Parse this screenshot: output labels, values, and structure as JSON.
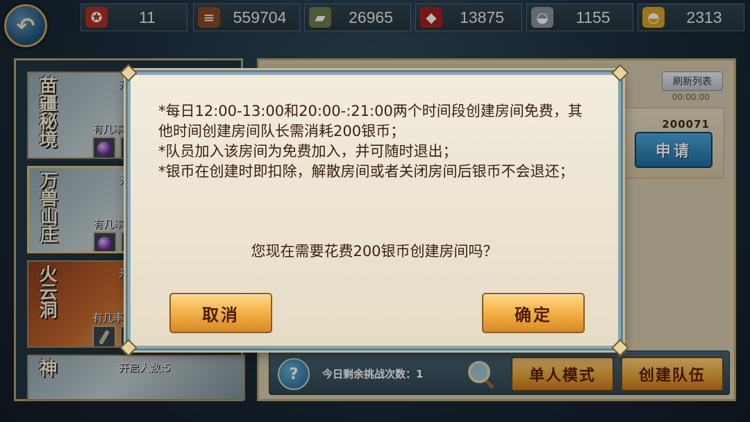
{
  "resources": [
    {
      "icon": "token-icon",
      "value": "11",
      "color": "#b23020"
    },
    {
      "icon": "wood-icon",
      "value": "559704",
      "color": "#8a4a22"
    },
    {
      "icon": "stone-icon",
      "value": "26965",
      "color": "#6f7a4a"
    },
    {
      "icon": "ore-icon",
      "value": "13875",
      "color": "#a32020"
    },
    {
      "icon": "silver-icon",
      "value": "1155",
      "color": "#c0c6cc"
    },
    {
      "icon": "gold-ingot-icon",
      "value": "2313",
      "color": "#d8a520"
    }
  ],
  "dungeons": [
    {
      "name": "苗疆秘境",
      "open": "开启",
      "chance": "有几率掉",
      "selected": false
    },
    {
      "name": "万兽山庄",
      "open": "开启",
      "chance": "有几率掉",
      "selected": true
    },
    {
      "name": "火云洞",
      "open": "开启",
      "chance": "有几率掉",
      "selected": false
    },
    {
      "name": "神",
      "open": "开启人数:5",
      "chance": "",
      "selected": false
    }
  ],
  "room_panel": {
    "refresh_label": "刷新列表",
    "timer": "00:00:00",
    "room_id": "200071",
    "apply_label": "申请"
  },
  "bottom_bar": {
    "challenges_text": "今日剩余挑战次数：1",
    "single_mode_label": "单人模式",
    "create_team_label": "创建队伍"
  },
  "dialog": {
    "line1": "*每日12:00-13:00和20:00-:21:00两个时间段创建房间免费，其他时间创建房间队长需消耗200银币；",
    "line2": "*队员加入该房间为免费加入，并可随时退出；",
    "line3": "*银币在创建时即扣除，解散房间或者关闭房间后银币不会退还；",
    "question": "您现在需要花费200银币创建房间吗？",
    "cancel_label": "取消",
    "confirm_label": "确定"
  }
}
